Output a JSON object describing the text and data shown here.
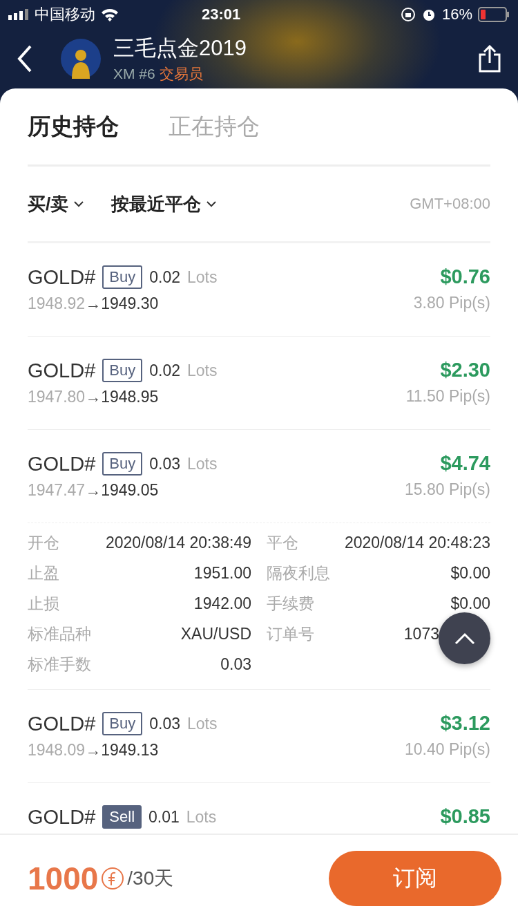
{
  "status_bar": {
    "carrier": "中国移动",
    "time": "23:01",
    "battery": "16%"
  },
  "header": {
    "title": "三毛点金2019",
    "broker": "XM #6",
    "role": "交易员"
  },
  "tabs": [
    {
      "label": "历史持仓",
      "selected": true
    },
    {
      "label": "正在持仓",
      "selected": false
    }
  ],
  "filters": [
    {
      "label": "买/卖"
    },
    {
      "label": "按最近平仓"
    }
  ],
  "timezone": "GMT+08:00",
  "trades": [
    {
      "symbol": "GOLD#",
      "side": "Buy",
      "kind": "buy",
      "lots": "0.02",
      "lots_unit": "Lots",
      "open": "1948.92",
      "arrow": "→",
      "close": "1949.30",
      "profit": "$0.76",
      "pips": "3.80 Pip(s)",
      "expanded": false
    },
    {
      "symbol": "GOLD#",
      "side": "Buy",
      "kind": "buy",
      "lots": "0.02",
      "lots_unit": "Lots",
      "open": "1947.80",
      "arrow": "→",
      "close": "1948.95",
      "profit": "$2.30",
      "pips": "11.50 Pip(s)",
      "expanded": false
    },
    {
      "symbol": "GOLD#",
      "side": "Buy",
      "kind": "buy",
      "lots": "0.03",
      "lots_unit": "Lots",
      "open": "1947.47",
      "arrow": "→",
      "close": "1949.05",
      "profit": "$4.74",
      "pips": "15.80 Pip(s)",
      "expanded": true,
      "details_left": [
        {
          "label": "开仓",
          "value": "2020/08/14 20:38:49"
        },
        {
          "label": "止盈",
          "value": "1951.00"
        },
        {
          "label": "止损",
          "value": "1942.00"
        },
        {
          "label": "标准品种",
          "value": "XAU/USD"
        },
        {
          "label": "标准手数",
          "value": "0.03"
        }
      ],
      "details_right": [
        {
          "label": "平仓",
          "value": "2020/08/14 20:48:23"
        },
        {
          "label": "隔夜利息",
          "value": "$0.00"
        },
        {
          "label": "手续费",
          "value": "$0.00"
        },
        {
          "label": "订单号",
          "value": "1073",
          "kind": "covered"
        }
      ]
    },
    {
      "symbol": "GOLD#",
      "side": "Buy",
      "kind": "buy",
      "lots": "0.03",
      "lots_unit": "Lots",
      "open": "1948.09",
      "arrow": "→",
      "close": "1949.13",
      "profit": "$3.12",
      "pips": "10.40 Pip(s)",
      "expanded": false
    },
    {
      "symbol": "GOLD#",
      "side": "Sell",
      "kind": "sell",
      "lots": "0.01",
      "lots_unit": "Lots",
      "profit": "$0.85",
      "expanded": false
    }
  ],
  "footer": {
    "price": "1000",
    "period": "/30天",
    "button": "订阅"
  }
}
